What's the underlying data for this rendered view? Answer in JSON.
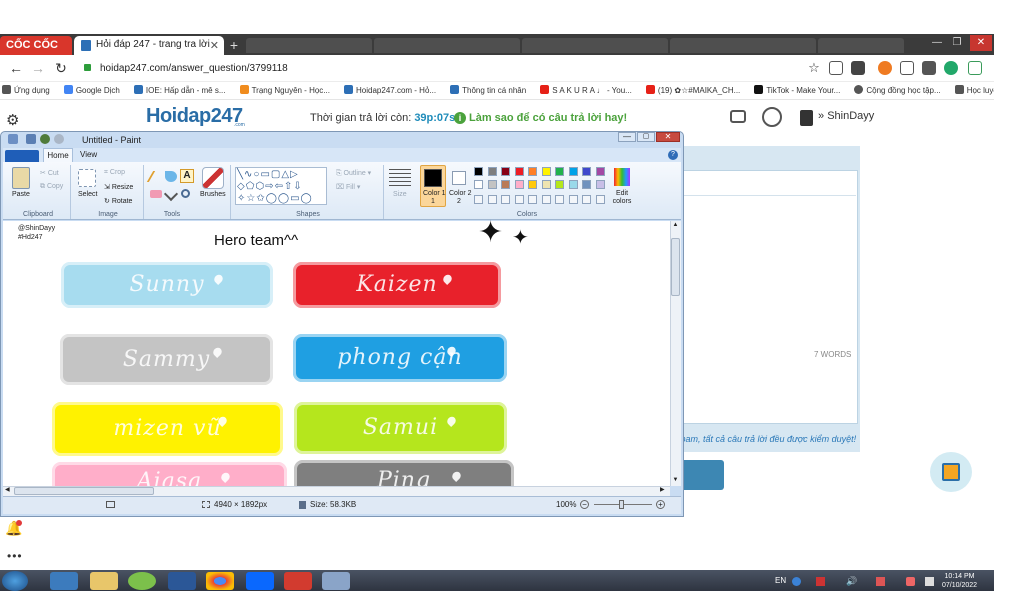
{
  "browser": {
    "brand": "CỐC CỐC",
    "active_tab_title": "Hỏi đáp 247 - trang tra lời",
    "address": "hoidap247.com/answer_question/3799118",
    "bookmarks": [
      {
        "label": "Ứng dụng",
        "color": "#555555"
      },
      {
        "label": "Google Dịch",
        "color": "#4285f4"
      },
      {
        "label": "IOE: Hấp dẫn - mê s...",
        "color": "#2d6fb6"
      },
      {
        "label": "Trạng Nguyên - Học...",
        "color": "#f08c1e"
      },
      {
        "label": "Hoidap247.com - Hỏ...",
        "color": "#2d6fb6"
      },
      {
        "label": "Thông tin cá nhân",
        "color": "#2d6fb6"
      },
      {
        "label": "S A K U R A ♩ - You...",
        "color": "#e62117"
      },
      {
        "label": "(19) ✿☆#MAIKA_CH...",
        "color": "#e62117"
      },
      {
        "label": "TikTok - Make Your...",
        "color": "#111111"
      },
      {
        "label": "Cộng đồng học tập...",
        "color": "#555555"
      },
      {
        "label": "Học luyện tiếng Việt...",
        "color": "#555555"
      }
    ]
  },
  "site": {
    "logo": "Hoidap247",
    "logo_sub": ".com",
    "timer_label": "Thời gian trả lời còn:",
    "timer_value": "39p:07s",
    "vote_text": "Làm sao để có câu trả lời hay!",
    "username": "ShinDayy",
    "words": "7 WORDS",
    "note": "spam, tất cả câu trả lời đều được kiểm duyệt!"
  },
  "paint": {
    "title": "Untitled - Paint",
    "tabs": {
      "home": "Home",
      "view": "View"
    },
    "clipboard": {
      "paste": "Paste",
      "cut": "Cut",
      "copy": "Copy",
      "group": "Clipboard"
    },
    "image": {
      "select": "Select",
      "crop": "Crop",
      "resize": "Resize",
      "rotate": "Rotate",
      "group": "Image"
    },
    "tools": {
      "group": "Tools",
      "brushes": "Brushes"
    },
    "shapes": {
      "group": "Shapes",
      "outline": "Outline",
      "fill": "Fill"
    },
    "size": "Size",
    "color1": "Color 1",
    "color1_num": "1",
    "color2": "Color 2",
    "color2_num": "2",
    "colors_group": "Colors",
    "edit_colors": "Edit colors",
    "palette": [
      "#000000",
      "#7f7f7f",
      "#880015",
      "#ed1c24",
      "#ff7f27",
      "#fff200",
      "#22b14c",
      "#00a2e8",
      "#3f48cc",
      "#a349a4",
      "#ffffff",
      "#c3c3c3",
      "#b97a57",
      "#ffaec9",
      "#ffc90e",
      "#efe4b0",
      "#b5e61d",
      "#99d9ea",
      "#7092be",
      "#c8bfe7"
    ],
    "canvas": {
      "credit1": "@ShinDayy",
      "credit2": "#Hd247",
      "heading": "Hero team^^",
      "banners": [
        {
          "text": "Sunny",
          "color": "#a7dcef"
        },
        {
          "text": "Kaizen",
          "color": "#e8212b"
        },
        {
          "text": "Sammy",
          "color": "#c4c4c4"
        },
        {
          "text": "phong cận",
          "color": "#1f9fe2"
        },
        {
          "text": "mizen vũ",
          "color": "#fff200"
        },
        {
          "text": "Samui",
          "color": "#b5e61d"
        },
        {
          "text": "Aiasa",
          "color": "#ffaec9"
        },
        {
          "text": "Ping",
          "color": "#7f7f7f"
        }
      ]
    },
    "status": {
      "dimensions": "4940 × 1892px",
      "size": "Size: 58.3KB",
      "zoom": "100%"
    }
  },
  "taskbar": {
    "lang": "EN",
    "time": "10:14 PM",
    "date": "07/10/2022"
  }
}
